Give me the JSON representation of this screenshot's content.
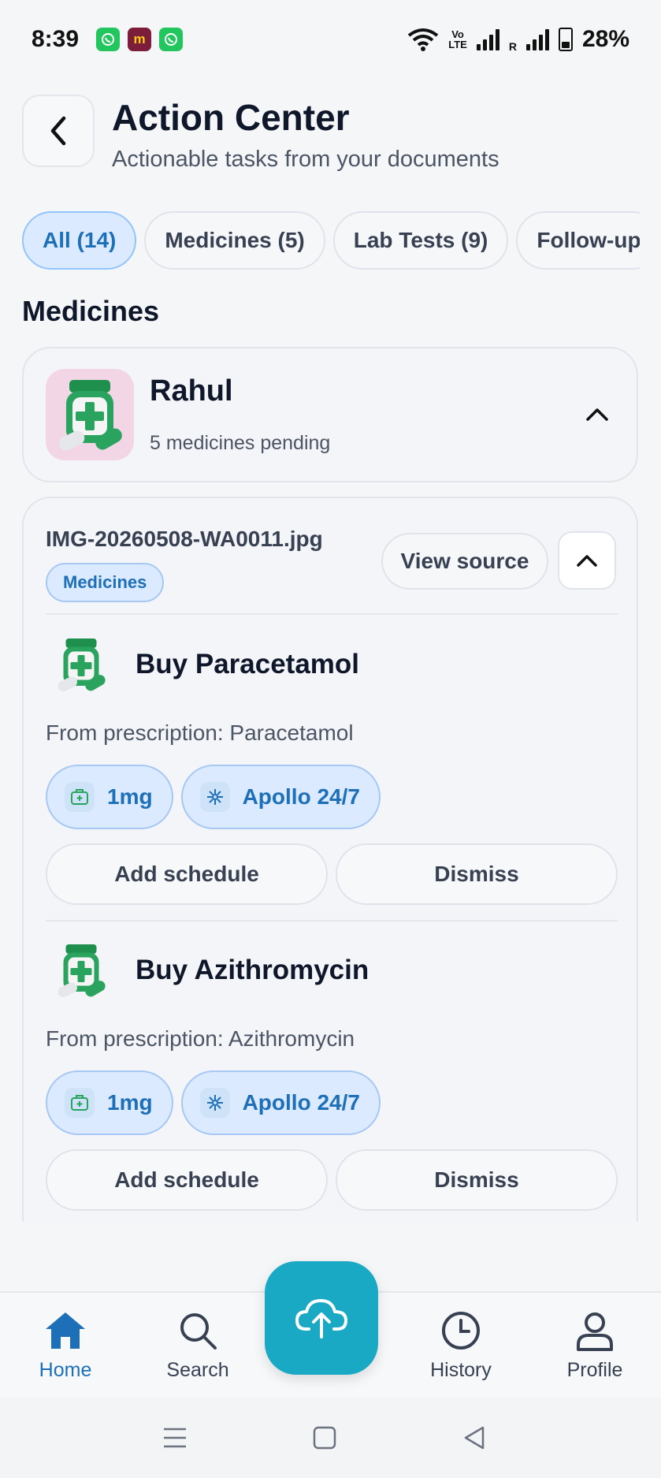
{
  "status_bar": {
    "time": "8:39",
    "apps": [
      {
        "name": "whatsapp-icon",
        "glyph": "✆"
      },
      {
        "name": "meesho-icon",
        "glyph": "m"
      },
      {
        "name": "whatsapp-icon",
        "glyph": "✆"
      }
    ],
    "volte": "Vo\nLTE",
    "roaming": "R",
    "battery": "28%"
  },
  "header": {
    "title": "Action Center",
    "subtitle": "Actionable tasks from your documents"
  },
  "filters": [
    {
      "label": "All (14)",
      "active": true
    },
    {
      "label": "Medicines (5)",
      "active": false
    },
    {
      "label": "Lab Tests (9)",
      "active": false
    },
    {
      "label": "Follow-up",
      "active": false
    }
  ],
  "section_title": "Medicines",
  "group": {
    "name": "Rahul",
    "subtitle": "5 medicines pending"
  },
  "document": {
    "filename": "IMG-20260508-WA0011.jpg",
    "badge": "Medicines",
    "view_source": "View source"
  },
  "tasks": [
    {
      "title": "Buy Paracetamol",
      "description": "From prescription: Paracetamol",
      "dose": "1mg",
      "pharmacy": "Apollo 24/7",
      "add_schedule": "Add schedule",
      "dismiss": "Dismiss"
    },
    {
      "title": "Buy Azithromycin",
      "description": "From prescription: Azithromycin",
      "dose": "1mg",
      "pharmacy": "Apollo 24/7",
      "add_schedule": "Add schedule",
      "dismiss": "Dismiss"
    }
  ],
  "nav": {
    "home": "Home",
    "search": "Search",
    "history": "History",
    "profile": "Profile"
  },
  "colors": {
    "accent": "#1d6fb8",
    "fab": "#19a9c4",
    "chip_active_bg": "#dbeafe"
  }
}
